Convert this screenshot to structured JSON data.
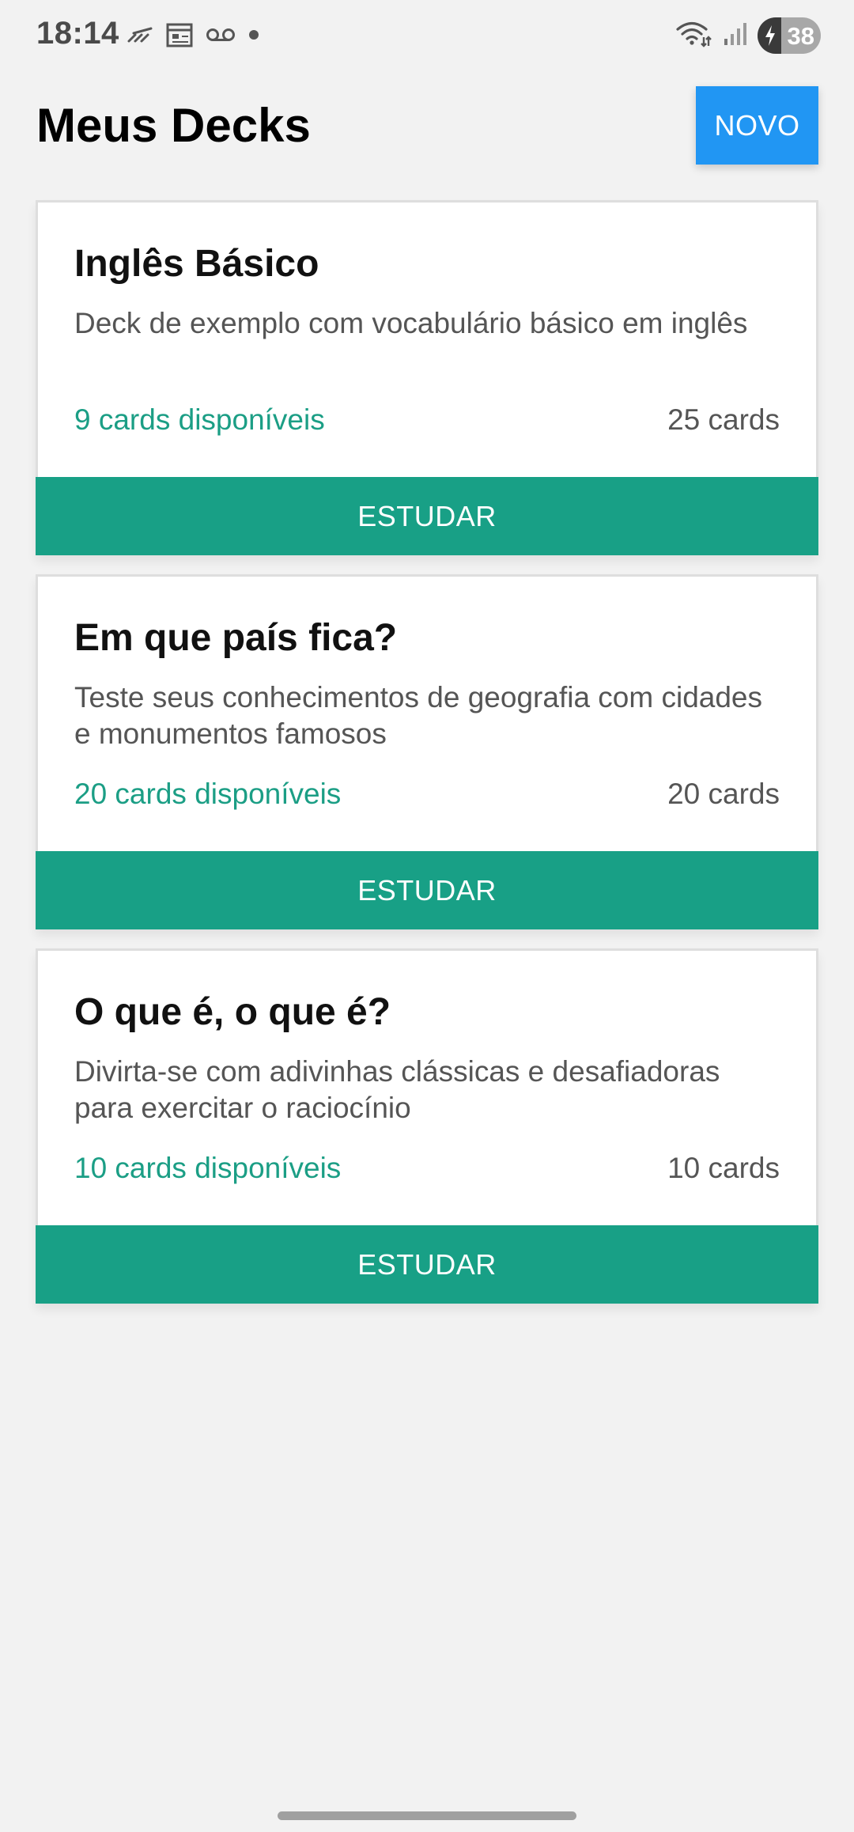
{
  "status_bar": {
    "time": "18:14",
    "battery_level": "38",
    "icons_left": [
      "missed-call-icon",
      "calendar-icon",
      "voicemail-icon",
      "dot-icon"
    ],
    "icons_right": [
      "wifi-icon",
      "signal-icon",
      "battery-icon"
    ]
  },
  "header": {
    "title": "Meus Decks",
    "new_button_label": "NOVO"
  },
  "decks": [
    {
      "title": "Inglês Básico",
      "description": "Deck de exemplo com vocabulário básico em inglês",
      "available": "9 cards disponíveis",
      "total": "25 cards",
      "study_label": "ESTUDAR"
    },
    {
      "title": "Em que país fica?",
      "description": "Teste seus conhecimentos de geografia com cidades e monumentos famosos",
      "available": "20 cards disponíveis",
      "total": "20 cards",
      "study_label": "ESTUDAR"
    },
    {
      "title": "O que é, o que é?",
      "description": "Divirta-se com adivinhas clássicas e desafiadoras para exercitar o raciocínio",
      "available": "10 cards disponíveis",
      "total": "10 cards",
      "study_label": "ESTUDAR"
    }
  ],
  "colors": {
    "background": "#f2f2f2",
    "primary_blue": "#2196f3",
    "study_green": "#18a086",
    "available_text": "#1b9e85",
    "muted_text": "#555555"
  }
}
